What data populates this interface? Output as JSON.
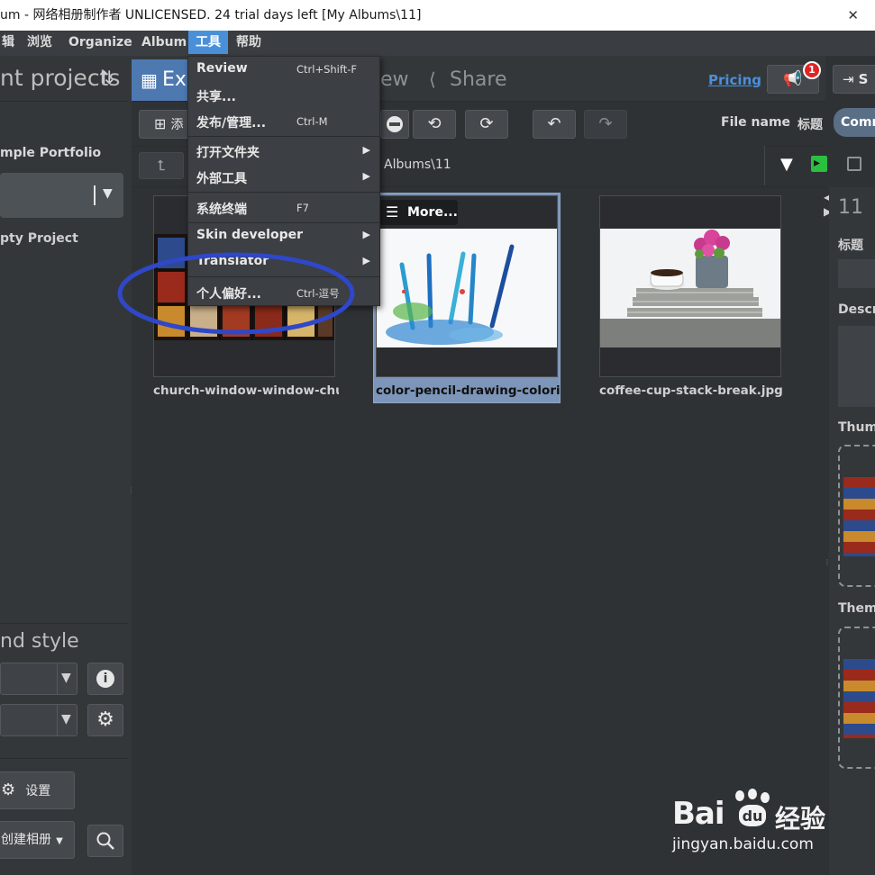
{
  "window": {
    "title": "um - 网络相册制作者 UNLICENSED. 24 trial days left [My Albums\\11]"
  },
  "menubar": {
    "items": [
      "辑",
      "浏览",
      "Organize",
      "Album",
      "工具",
      "帮助"
    ],
    "active_index": 4
  },
  "left_panel": {
    "header": "nt projects",
    "projects": [
      "mple Portfolio",
      "pty Project"
    ],
    "style_header": "nd style",
    "settings_label": "设置",
    "create_album_label": "创建相册"
  },
  "toolbar": {
    "tabs": [
      "Ex",
      "ew",
      "Share"
    ],
    "pricing_label": "Pricing",
    "notification_count": "1",
    "share_short": "S",
    "add_short": "添",
    "sort_labels": [
      "File name",
      "标题",
      "Comm"
    ],
    "path_text": "Albums\\11"
  },
  "menu_tools": {
    "items": [
      {
        "label": "Review",
        "shortcut": "Ctrl+Shift-F",
        "submenu": false
      },
      {
        "label": "共享...",
        "shortcut": "",
        "submenu": false
      },
      {
        "label": "发布/管理...",
        "shortcut": "Ctrl-M",
        "submenu": false
      },
      {
        "label": "打开文件夹",
        "shortcut": "",
        "submenu": true
      },
      {
        "label": "外部工具",
        "shortcut": "",
        "submenu": true
      },
      {
        "label": "系统终端",
        "shortcut": "F7",
        "submenu": false
      },
      {
        "label": "Skin developer",
        "shortcut": "",
        "submenu": true
      },
      {
        "label": "Translator",
        "shortcut": "",
        "submenu": true
      },
      {
        "label": "个人偏好...",
        "shortcut": "Ctrl-逗号",
        "submenu": false
      }
    ]
  },
  "gallery": {
    "more_label": "More...",
    "items": [
      {
        "filename": "church-window-window-church",
        "selected": false
      },
      {
        "filename": "color-pencil-drawing-coloring",
        "selected": true
      },
      {
        "filename": "coffee-cup-stack-break.jpg",
        "selected": false
      }
    ]
  },
  "right_panel": {
    "folder_name": "11",
    "labels": [
      "标题",
      "Descr",
      "Thum",
      "Them"
    ]
  },
  "watermark": {
    "brand": "Bai",
    "brand2": "经验",
    "url": "jingyan.baidu.com"
  },
  "colors": {
    "accent": "#4a90d9",
    "highlight_circle": "#2f47c9",
    "badge": "#e02424",
    "link": "#4a90d9"
  }
}
